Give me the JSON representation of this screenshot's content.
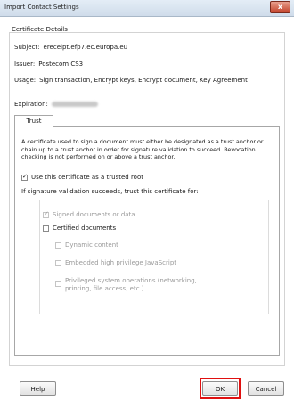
{
  "window": {
    "title": "Import Contact Settings",
    "close_glyph": "x"
  },
  "certificate": {
    "section_title": "Certificate Details",
    "subject_label": "Subject:",
    "subject_value": "ereceipt.efp7.ec.europa.eu",
    "issuer_label": "Issuer:",
    "issuer_value": "Postecom CS3",
    "usage_label": "Usage:",
    "usage_value": "Sign transaction, Encrypt keys, Encrypt document, Key Agreement",
    "expiration_label": "Expiration:"
  },
  "tabs": {
    "trust_label": "Trust"
  },
  "trust": {
    "description": "A certificate used to sign a document must either be designated as a trust anchor or chain up to a trust anchor in order for signature validation to succeed.  Revocation checking is not performed on or above a trust anchor.",
    "use_as_root_label": "Use this certificate as a trusted root",
    "use_as_root_checked": true,
    "if_succeeds_label": "If signature validation succeeds, trust this certificate for:",
    "options": {
      "signed_docs": {
        "label": "Signed documents or data",
        "checked": true,
        "enabled": false
      },
      "certified_docs": {
        "label": "Certified documents",
        "checked": false,
        "enabled": true
      },
      "dynamic_content": {
        "label": "Dynamic content",
        "checked": false,
        "enabled": false
      },
      "embedded_js": {
        "label": "Embedded high privilege JavaScript",
        "checked": false,
        "enabled": false
      },
      "privileged_ops": {
        "label": "Privileged system operations (networking, printing, file access, etc.)",
        "checked": false,
        "enabled": false
      }
    }
  },
  "buttons": {
    "help": "Help",
    "ok": "OK",
    "cancel": "Cancel"
  },
  "colors": {
    "highlight": "#e01010"
  }
}
